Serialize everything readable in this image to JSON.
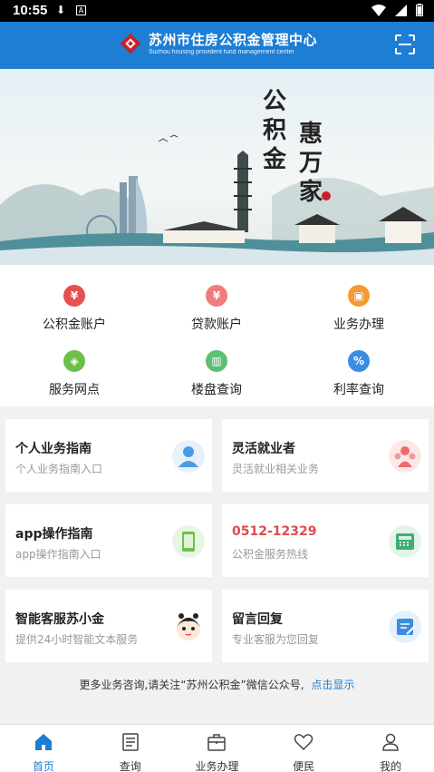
{
  "status_bar": {
    "time": "10:55"
  },
  "header": {
    "title": "苏州市住房公积金管理中心",
    "subtitle": "Suzhou housing provident fund management center"
  },
  "banner": {
    "slogan_line1": "公积金",
    "slogan_line2": "惠万家"
  },
  "grid": [
    {
      "label": "公积金账户",
      "icon": "yuan-icon",
      "color": "#e55050"
    },
    {
      "label": "贷款账户",
      "icon": "loan-icon",
      "color": "#f07c7c"
    },
    {
      "label": "业务办理",
      "icon": "briefcase-icon",
      "color": "#f59a2f"
    },
    {
      "label": "服务网点",
      "icon": "network-point-icon",
      "color": "#6cc04a"
    },
    {
      "label": "楼盘查询",
      "icon": "building-icon",
      "color": "#5cbf72"
    },
    {
      "label": "利率查询",
      "icon": "percent-icon",
      "color": "#3a8ee0"
    }
  ],
  "cards": [
    {
      "title": "个人业务指南",
      "subtitle": "个人业务指南入口",
      "icon": "person-icon"
    },
    {
      "title": "灵活就业者",
      "subtitle": "灵活就业相关业务",
      "icon": "people-group-icon"
    },
    {
      "title": "app操作指南",
      "subtitle": "app操作指南入口",
      "icon": "phone-icon"
    },
    {
      "title": "0512-12329",
      "subtitle": "公积金服务热线",
      "icon": "telephone-icon"
    },
    {
      "title": "智能客服苏小金",
      "subtitle": "提供24小时智能文本服务",
      "icon": "chatbot-avatar-icon"
    },
    {
      "title": "留言回复",
      "subtitle": "专业客服为您回复",
      "icon": "edit-message-icon"
    }
  ],
  "notice": {
    "text": "更多业务咨询,请关注“苏州公积金”微信公众号,",
    "link": "点击显示"
  },
  "tabs": [
    {
      "label": "首页",
      "icon": "home-icon",
      "active": true
    },
    {
      "label": "查询",
      "icon": "document-icon"
    },
    {
      "label": "业务办理",
      "icon": "briefcase-icon"
    },
    {
      "label": "便民",
      "icon": "heart-icon"
    },
    {
      "label": "我的",
      "icon": "user-icon"
    }
  ],
  "colors": {
    "primary": "#1d7ed3",
    "hotline": "#e24a4a"
  }
}
